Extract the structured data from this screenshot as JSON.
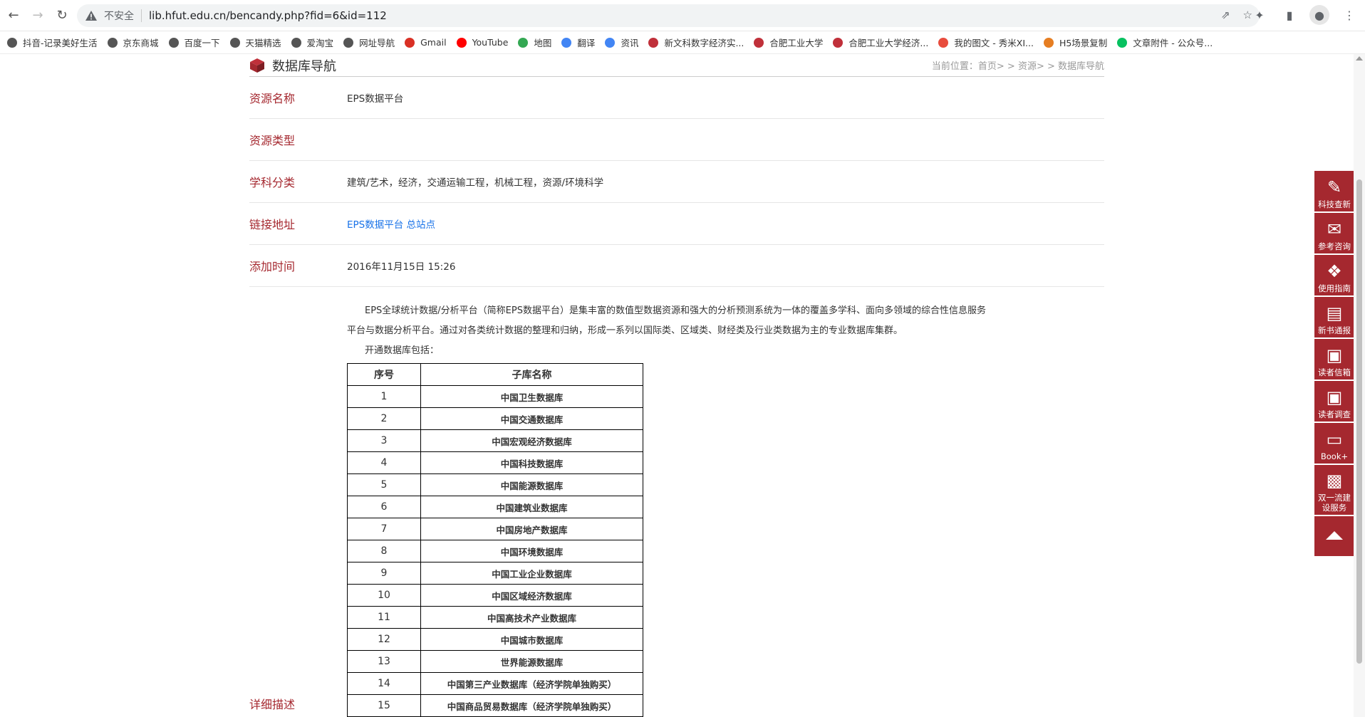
{
  "browser": {
    "security_label": "不安全",
    "url": "lib.hfut.edu.cn/bencandy.php?fid=6&id=112",
    "bookmarks": [
      "抖音-记录美好生活",
      "京东商城",
      "百度一下",
      "天猫精选",
      "爱淘宝",
      "网址导航",
      "Gmail",
      "YouTube",
      "地图",
      "翻译",
      "资讯",
      "新文科数字经济实...",
      "合肥工业大学",
      "合肥工业大学经济...",
      "我的图文 - 秀米XI...",
      "H5场景复制",
      "文章附件 - 公众号..."
    ]
  },
  "header": {
    "title": "数据库导航",
    "breadcrumb": "当前位置：首页> > 资源> > 数据库导航"
  },
  "fields": [
    {
      "key": "资源名称",
      "value": "EPS数据平台"
    },
    {
      "key": "资源类型",
      "value": ""
    },
    {
      "key": "学科分类",
      "value": "建筑/艺术，经济，交通运输工程，机械工程，资源/环境科学"
    },
    {
      "key": "链接地址",
      "value": "EPS数据平台 总站点"
    },
    {
      "key": "添加时间",
      "value": "2016年11月15日 15:26"
    }
  ],
  "description": {
    "label": "详细描述",
    "para1": "EPS全球统计数据/分析平台（简称EPS数据平台）是集丰富的数值型数据资源和强大的分析预测系统为一体的覆盖多学科、面向多领域的综合性信息服务",
    "para2": "平台与数据分析平台。通过对各类统计数据的整理和归纳，形成一系列以国际类、区域类、财经类及行业类数据为主的专业数据库集群。",
    "para3": "开通数据库包括：",
    "table_headers": [
      "序号",
      "子库名称"
    ],
    "rows": [
      [
        "1",
        "中国卫生数据库"
      ],
      [
        "2",
        "中国交通数据库"
      ],
      [
        "3",
        "中国宏观经济数据库"
      ],
      [
        "4",
        "中国科技数据库"
      ],
      [
        "5",
        "中国能源数据库"
      ],
      [
        "6",
        "中国建筑业数据库"
      ],
      [
        "7",
        "中国房地产数据库"
      ],
      [
        "8",
        "中国环境数据库"
      ],
      [
        "9",
        "中国工业企业数据库"
      ],
      [
        "10",
        "中国区域经济数据库"
      ],
      [
        "11",
        "中国高技术产业数据库"
      ],
      [
        "12",
        "中国城市数据库"
      ],
      [
        "13",
        "世界能源数据库"
      ],
      [
        "14",
        "中国第三产业数据库（经济学院单独购买）"
      ],
      [
        "15",
        "中国商品贸易数据库（经济学院单独购买）"
      ]
    ]
  },
  "side_nav": [
    "科技查新",
    "参考咨询",
    "使用指南",
    "新书通报",
    "读者信箱",
    "读者调查",
    "Book+",
    "双一流建设服务"
  ],
  "colors": {
    "accent": "#a5282f",
    "link": "#1a73e8"
  }
}
